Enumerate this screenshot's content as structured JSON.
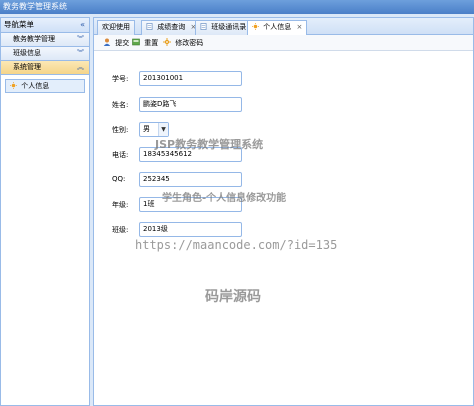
{
  "window": {
    "title": "教务教学管理系统"
  },
  "sidebar": {
    "header": "导航菜单",
    "collapse_glyph": "«",
    "sections": [
      {
        "label": "教务教学管理",
        "chevron": "︾"
      },
      {
        "label": "班级信息",
        "chevron": "︾"
      },
      {
        "label": "系统管理",
        "chevron": "︽"
      }
    ],
    "active_item": "个人信息"
  },
  "tabs": [
    {
      "label": "欢迎使用"
    },
    {
      "label": "成绩查询",
      "close": "×"
    },
    {
      "label": "班级通讯录",
      "close": "×"
    },
    {
      "label": "个人信息",
      "close": "×"
    }
  ],
  "toolbar": {
    "submit": "提交",
    "reset": "重置",
    "change_password": "修改密码"
  },
  "form": {
    "student_id": {
      "label": "学号:",
      "value": "201301001"
    },
    "name": {
      "label": "姓名:",
      "value": "鹏姿D路飞"
    },
    "gender": {
      "label": "性别:",
      "value": "男"
    },
    "phone": {
      "label": "电话:",
      "value": "18345345612"
    },
    "qq": {
      "label": "QQ:",
      "value": "252345"
    },
    "grade": {
      "label": "年级:",
      "value": "1班"
    },
    "class": {
      "label": "班级:",
      "value": "2013级"
    }
  },
  "watermarks": {
    "system": "JSP教务教学管理系统",
    "feature": "学生角色-个人信息修改功能",
    "url": "https://maancode.com/?id=135",
    "brand": "码岸源码"
  },
  "colors": {
    "border": "#99bbe8",
    "titlebar": "#4a7fc8",
    "active_section": "#f5d58a"
  }
}
